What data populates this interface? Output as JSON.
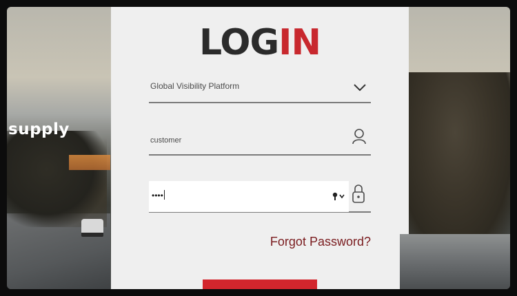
{
  "background": {
    "tagline_fragment": "supply"
  },
  "login": {
    "title_part1": "LOG",
    "title_part2": "IN",
    "platform_value": "Global Visibility Platform",
    "username_value": "customer",
    "password_masked": "••••",
    "forgot_label": "Forgot Password?"
  },
  "icons": {
    "dropdown": "chevron-down-icon",
    "user": "user-icon",
    "key": "key-icon",
    "lock": "lock-icon"
  },
  "colors": {
    "accent": "#c8282e",
    "link": "#7a1c1f",
    "panel": "#efefef"
  }
}
